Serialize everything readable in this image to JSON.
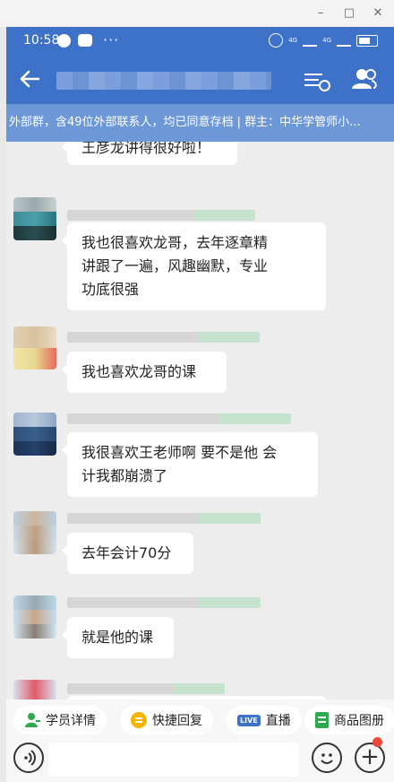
{
  "window": {
    "controls": [
      "–",
      "□",
      "✕"
    ]
  },
  "status_bar": {
    "time": "10:58",
    "more": "···",
    "network_1": "4G",
    "network_2": "4G"
  },
  "header": {
    "back_icon": "arrow-left-icon",
    "menu_icon": "list-settings-icon",
    "members_icon": "group-members-icon"
  },
  "banner": {
    "text": "外部群，含49位外部联系人，均已同意存档 | 群主：中华学管师小..."
  },
  "messages": [
    {
      "text": "王彦龙讲得很好啦！"
    },
    {
      "text_line1": "我也很喜欢龙哥，去年逐章精",
      "text_line2": "讲跟了一遍，风趣幽默，专业",
      "text_line3": "功底很强"
    },
    {
      "text": "我也喜欢龙哥的课"
    },
    {
      "text_line1": "我很喜欢王老师啊 要不是他 会",
      "text_line2": "计我都崩溃了"
    },
    {
      "text": "去年会计70分"
    },
    {
      "text": "就是他的课"
    }
  ],
  "toolbar": {
    "items": [
      {
        "label": "学员详情",
        "icon": "student-icon",
        "color": "#2fa84f"
      },
      {
        "label": "快捷回复",
        "icon": "quick-reply-icon",
        "color": "#f5b400"
      },
      {
        "label": "直播",
        "badge": "LIVE",
        "icon": "live-icon",
        "color": "#3d72c8"
      },
      {
        "label": "商品图册",
        "icon": "catalog-icon",
        "color": "#2fa84f"
      }
    ]
  },
  "input_bar": {
    "voice_icon": "voice-icon",
    "emoji_icon": "emoji-icon",
    "plus_icon": "plus-icon",
    "placeholder": ""
  },
  "colors": {
    "header": "#3d72c8",
    "banner": "#6d98d8",
    "chat_bg": "#ededed",
    "notification": "#e84b3c"
  }
}
